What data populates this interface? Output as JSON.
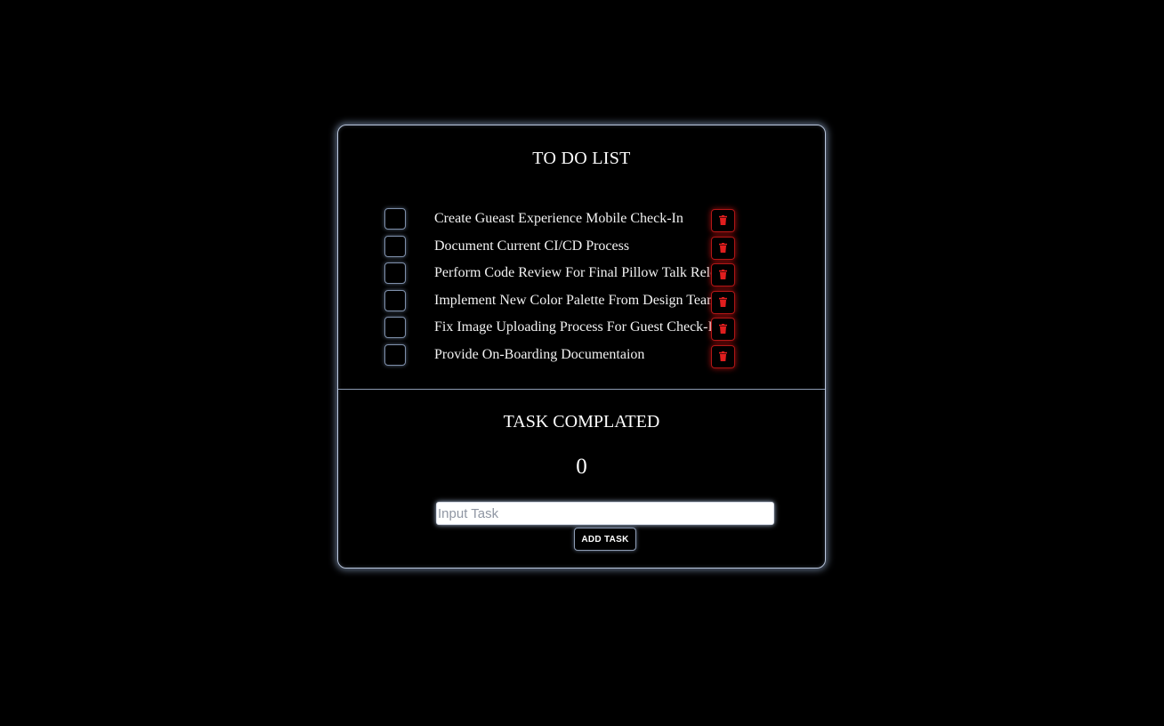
{
  "app": {
    "title": "TO DO LIST"
  },
  "tasks": [
    {
      "text": "Create Gueast Experience Mobile Check-In",
      "checked": false
    },
    {
      "text": "Document Current CI/CD Process",
      "checked": false
    },
    {
      "text": "Perform Code Review For Final Pillow Talk Release",
      "checked": false
    },
    {
      "text": "Implement New Color Palette From Design Team",
      "checked": false
    },
    {
      "text": "Fix Image Uploading Process For Guest Check-In",
      "checked": false
    },
    {
      "text": "Provide On-Boarding Documentaion",
      "checked": false
    }
  ],
  "completed": {
    "title": "TASK COMPLATED",
    "count": "0"
  },
  "input": {
    "placeholder": "Input Task",
    "value": ""
  },
  "add_button": {
    "label": "ADD TASK"
  },
  "icons": {
    "delete": "trash-icon"
  },
  "colors": {
    "background": "#000000",
    "card_border": "#b9c6dc",
    "delete_accent": "#d41a1a"
  }
}
